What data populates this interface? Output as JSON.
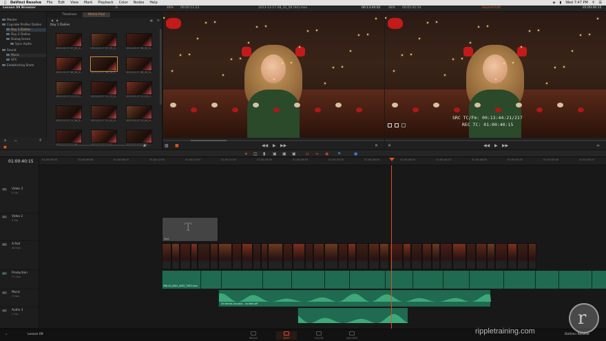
{
  "menubar": {
    "app": "DaVinci Resolve",
    "items": [
      "File",
      "Edit",
      "View",
      "Mark",
      "Playback",
      "Color",
      "Nodes",
      "Help"
    ],
    "clock": "Wed 7:47 PM"
  },
  "topbar": {
    "browser_title": "Lesson 09 Browser",
    "source_zoom": "48%",
    "source_tc": "00:00:11:22",
    "source_clip": "2013-12-17 08_32_58 (hd).mov",
    "source_dur": "00:13:44:02",
    "record_zoom": "48%",
    "record_tc": "00:05:41:14",
    "timeline_name": "Second Edit",
    "record_dur": "01:00:40:15"
  },
  "browser": {
    "tree": [
      {
        "label": "Master",
        "indent": 0
      },
      {
        "label": "Cupcake ProRes Dailies",
        "indent": 0
      },
      {
        "label": "Day 1 Dailies",
        "indent": 1,
        "selected": true
      },
      {
        "label": "Day 2 Dailies",
        "indent": 1
      },
      {
        "label": "Dialog Scene",
        "indent": 1
      },
      {
        "label": "Sync Audio",
        "indent": 2
      },
      {
        "label": "Sound",
        "indent": 0
      },
      {
        "label": "Music",
        "indent": 1
      },
      {
        "label": "SFX",
        "indent": 1
      },
      {
        "label": "Establishing Shots",
        "indent": 0
      }
    ],
    "tabs": [
      {
        "label": "Timelines",
        "active": false
      },
      {
        "label": "Media Pool",
        "active": true
      }
    ],
    "bin_title": "Day 1 Dailies",
    "thumbs": [
      "2013-12-17 07_32_4...",
      "2013-12-17 07_35_3...",
      "2013-12-17 08_32_0...",
      "2013-12-17 08_16_0...",
      "2013-12-17 08_32_5...",
      "2013-12-17 08_40_5...",
      "2013-12-17 11_13_1...",
      "2013-12-17 11_11_0...",
      "2013-12-17 11_14_1...",
      "2013-12-17 11_36_0...",
      "2013-12-17 11_41_3...",
      "2013-12-17 11_44_0...",
      "2013-12-17 11_49_...",
      "2013-12-17 11_51_...",
      "2013-12-17 11_56_..."
    ]
  },
  "viewer": {
    "src_tc_label": "SRC TC/Fm: 00:13:44:21/217",
    "rec_tc_label": "REC TC: 01:00:40:15"
  },
  "timeline": {
    "timecode": "01:00:40:15",
    "ruler": [
      "01:00:00:00",
      "01:00:06:06",
      "01:00:08:19",
      "01:00:12:00",
      "01:00:17:00",
      "01:00:21:00",
      "01:00:25:06",
      "01:00:28:00",
      "01:00:32:00",
      "01:00:36:00",
      "01:00:40:00",
      "01:00:44:15",
      "01:00:48:00",
      "01:00:51:00",
      "01:00:55:08",
      "01:01:04:15"
    ],
    "tracks": [
      {
        "badge": "V3",
        "name": "Video 3",
        "sub": "0 Clip"
      },
      {
        "badge": "V2",
        "name": "Video 2",
        "sub": "0 Clip"
      },
      {
        "badge": "V1",
        "name": "A Roll",
        "sub": "46 Clips"
      },
      {
        "badge": "A1",
        "name": "Production",
        "sub": "37 Clips"
      },
      {
        "badge": "A2",
        "name": "Music",
        "sub": "2 Clips"
      },
      {
        "badge": "A3",
        "name": "Audio 3",
        "sub": "1 Clip"
      }
    ],
    "title_clip": "Text",
    "audio_clip1": "MNLA2_0001_0001_T003.mov",
    "music_clip": "Christmas Acoustic - no fade.aiff"
  },
  "pagebar": {
    "project": "Lesson 09",
    "pages": [
      {
        "label": "MEDIA",
        "active": false
      },
      {
        "label": "EDIT",
        "active": true
      },
      {
        "label": "COLOR",
        "active": false
      },
      {
        "label": "DELIVER",
        "active": false
      }
    ],
    "app_label": "DaVinci Resolve"
  },
  "watermark": "rippletraining.com",
  "colors": {
    "accent": "#e05020",
    "audio": "#1f6a50",
    "selected": "#d89040"
  }
}
